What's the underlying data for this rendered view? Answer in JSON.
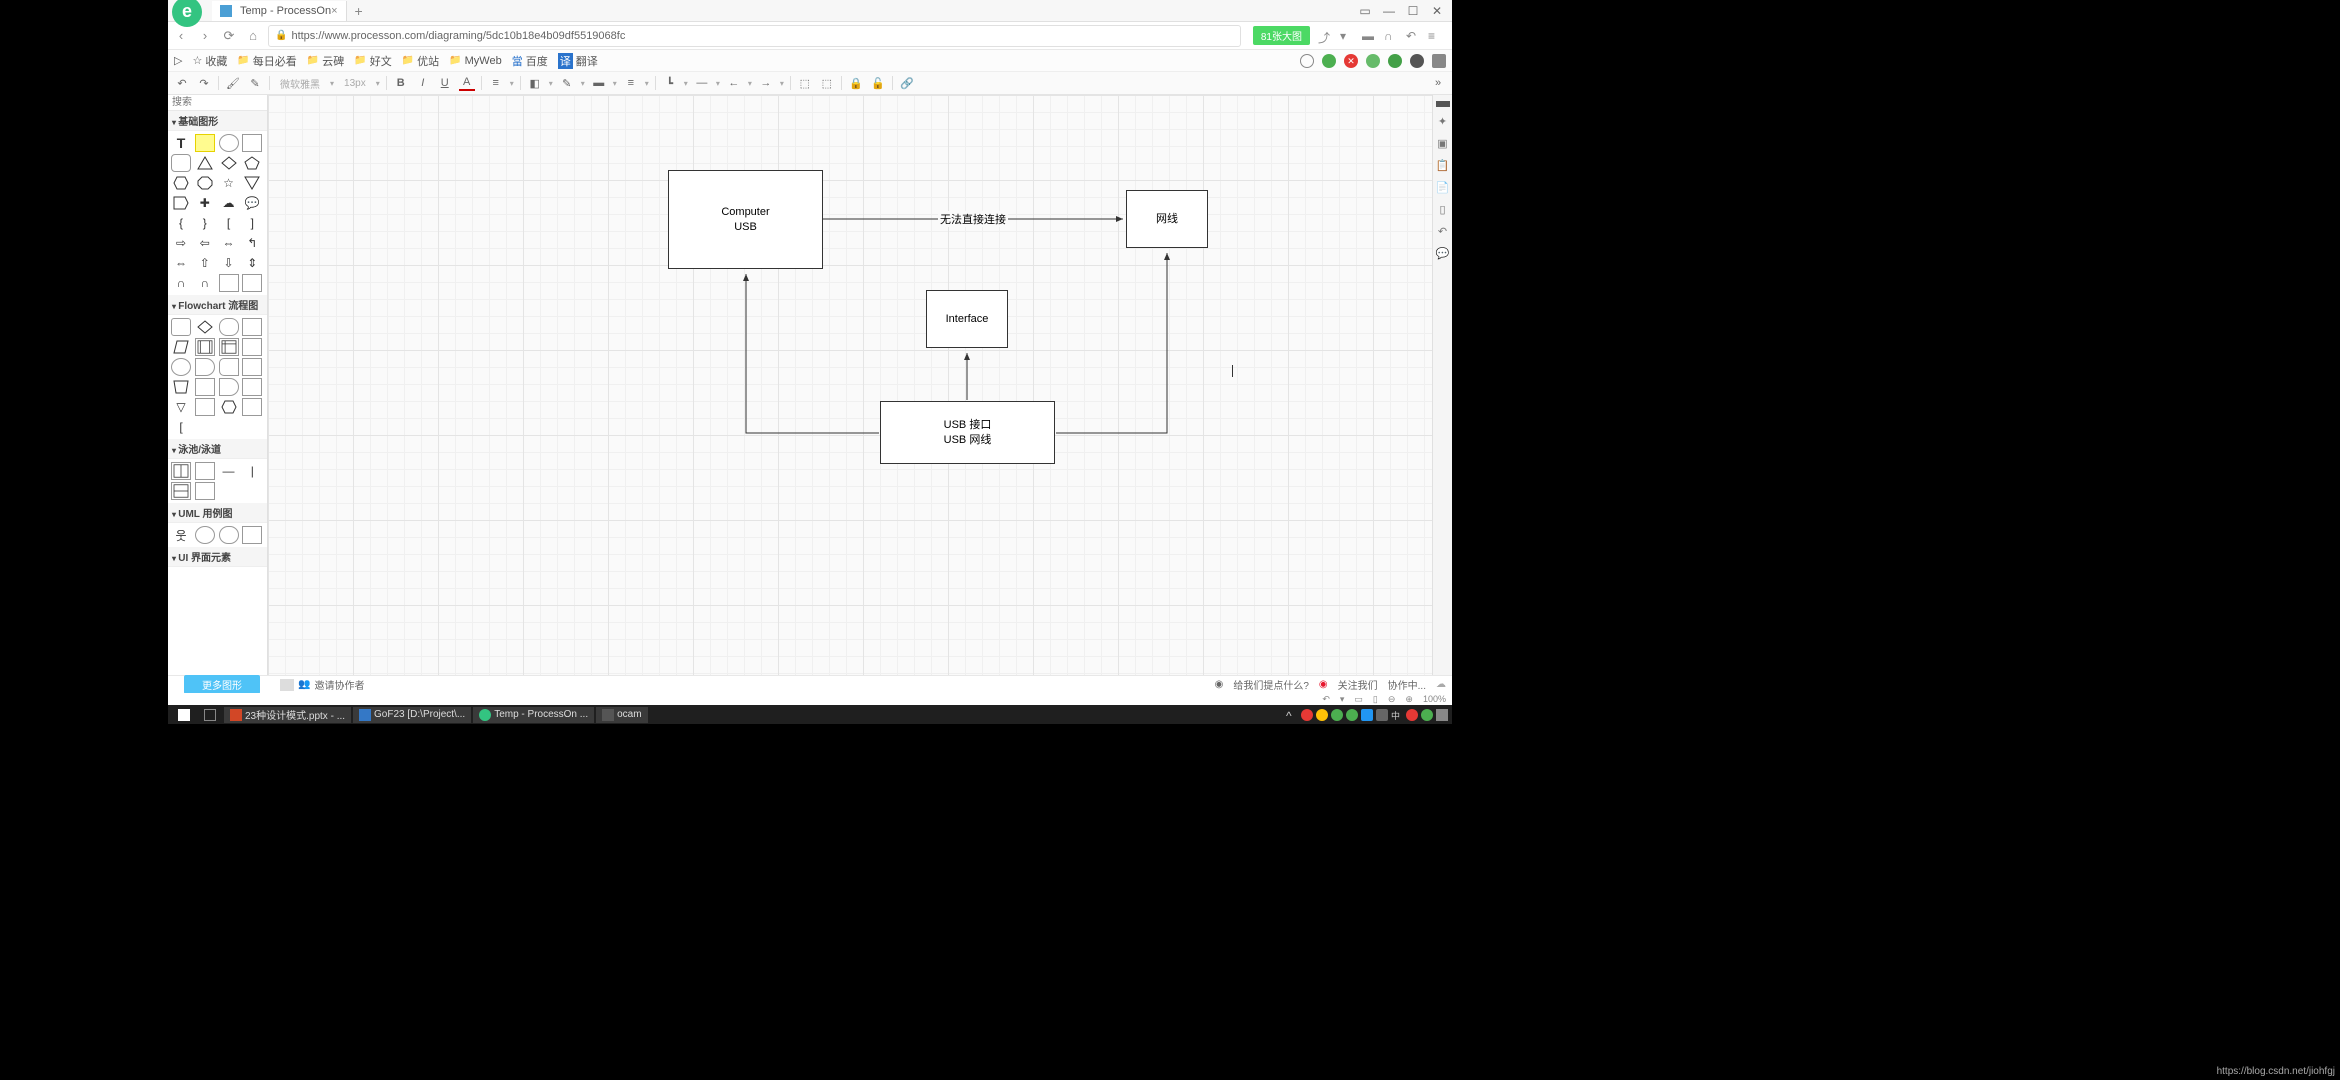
{
  "browser": {
    "tab_title": "Temp - ProcessOn",
    "url": "https://www.processon.com/diagraming/5dc10b18e4b09df5519068fc",
    "pill_text": "81张大图",
    "win_min": "—",
    "win_max": "☐",
    "win_close": "✕"
  },
  "bookmarks": {
    "b1": "收藏",
    "b2": "每日必看",
    "b3": "云碑",
    "b4": "好文",
    "b5": "优站",
    "b6": "MyWeb",
    "b7": "百度",
    "b8": "翻译"
  },
  "toolbar": {
    "font_hint": "微软雅黑",
    "font_size": "13px"
  },
  "shapes_categories": {
    "c1": "基础图形",
    "c2": "Flowchart 流程图",
    "c3": "泳池/泳道",
    "c4": "UML 用例图",
    "c5": "UI 界面元素"
  },
  "search": {
    "placeholder": "搜索"
  },
  "diagram": {
    "node1_line1": "Computer",
    "node1_line2": "USB",
    "node2": "网线",
    "node3": "Interface",
    "node4_line1": "USB 接口",
    "node4_line2": "USB 网线",
    "edge1_label": "无法直接连接"
  },
  "footer": {
    "more_shapes": "更多图形",
    "invite": "邀请协作者",
    "feedback": "给我们提点什么?",
    "follow": "关注我们",
    "syncing": "协作中...",
    "zoom": "100%"
  },
  "taskbar": {
    "t1": "23种设计模式.pptx - ...",
    "t2": "GoF23 [D:\\Project\\...",
    "t3": "Temp - ProcessOn ...",
    "t4": "ocam"
  },
  "watermark": "https://blog.csdn.net/jiohfgj"
}
